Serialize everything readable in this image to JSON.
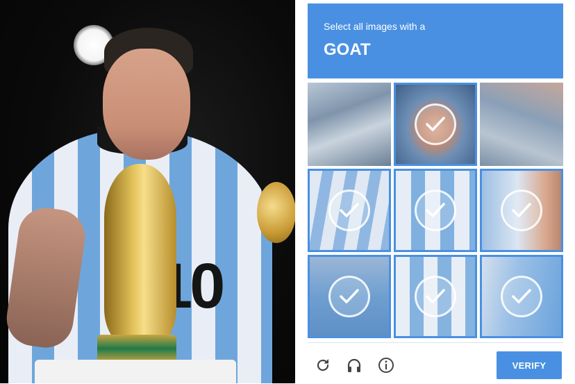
{
  "captcha": {
    "instruction": "Select all images with a",
    "target": "GOAT",
    "accent_color": "#4a90e2",
    "tiles": [
      {
        "row": 1,
        "col": 1,
        "selected": false,
        "icon": "none"
      },
      {
        "row": 1,
        "col": 2,
        "selected": true,
        "icon": "checkmark-icon"
      },
      {
        "row": 1,
        "col": 3,
        "selected": false,
        "icon": "none"
      },
      {
        "row": 2,
        "col": 1,
        "selected": true,
        "icon": "checkmark-icon"
      },
      {
        "row": 2,
        "col": 2,
        "selected": true,
        "icon": "checkmark-icon"
      },
      {
        "row": 2,
        "col": 3,
        "selected": true,
        "icon": "checkmark-icon"
      },
      {
        "row": 3,
        "col": 1,
        "selected": true,
        "icon": "checkmark-icon"
      },
      {
        "row": 3,
        "col": 2,
        "selected": true,
        "icon": "checkmark-icon"
      },
      {
        "row": 3,
        "col": 3,
        "selected": true,
        "icon": "checkmark-icon"
      }
    ],
    "footer": {
      "reload_icon": "reload-icon",
      "audio_icon": "headphones-icon",
      "info_icon": "info-icon",
      "verify_label": "VERIFY"
    }
  },
  "photo": {
    "jersey_number": "10"
  }
}
